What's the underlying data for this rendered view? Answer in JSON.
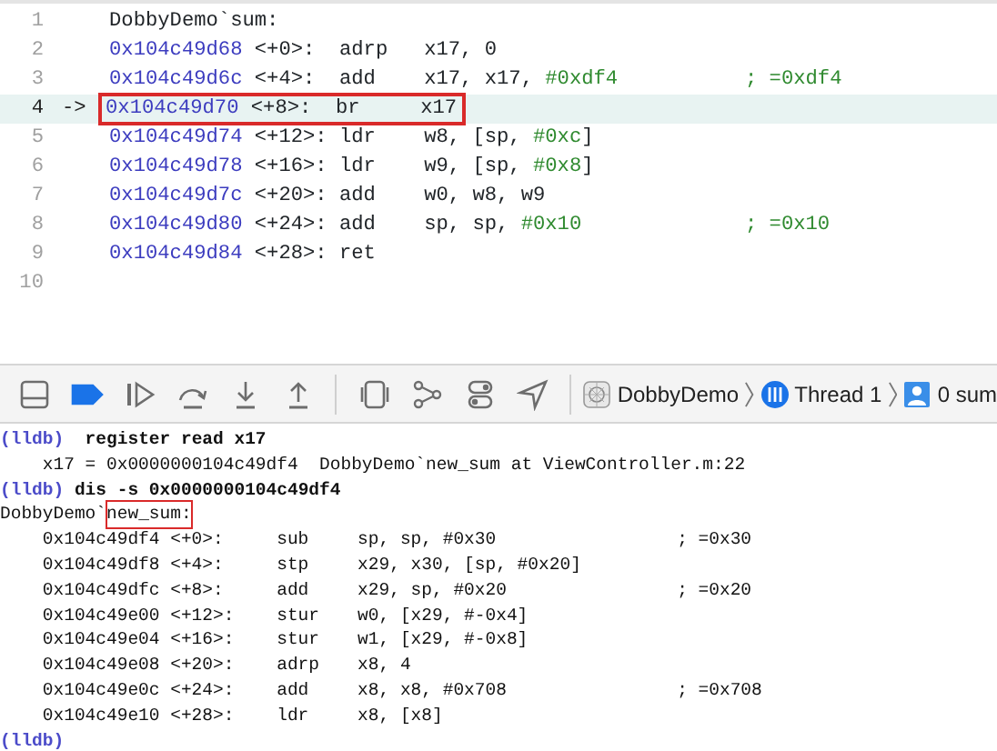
{
  "editor": {
    "lines": [
      {
        "number": "1",
        "kind": "label",
        "text": "DobbyDemo`sum:",
        "current": false,
        "annotated": false
      },
      {
        "number": "2",
        "kind": "instruction",
        "address": "0x104c49d68",
        "offset": "<+0>:",
        "mnemonic": "adrp",
        "operands": [
          {
            "kind": "plain",
            "text": "x17, 0"
          }
        ],
        "current": false,
        "annotated": false
      },
      {
        "number": "3",
        "kind": "instruction",
        "address": "0x104c49d6c",
        "offset": "<+4>:",
        "mnemonic": "add",
        "operands": [
          {
            "kind": "plain",
            "text": "x17, x17, "
          },
          {
            "kind": "imm",
            "text": "#0xdf4"
          }
        ],
        "comment": "; =0xdf4",
        "current": false,
        "annotated": false
      },
      {
        "number": "4",
        "kind": "instruction",
        "marker": "->",
        "address": "0x104c49d70",
        "offset": "<+8>:",
        "mnemonic": "br",
        "operands": [
          {
            "kind": "plain",
            "text": "x17"
          }
        ],
        "current": true,
        "annotated": true
      },
      {
        "number": "5",
        "kind": "instruction",
        "address": "0x104c49d74",
        "offset": "<+12>:",
        "mnemonic": "ldr",
        "operands": [
          {
            "kind": "plain",
            "text": "w8, [sp, "
          },
          {
            "kind": "imm",
            "text": "#0xc"
          },
          {
            "kind": "plain",
            "text": "]"
          }
        ],
        "current": false,
        "annotated": false
      },
      {
        "number": "6",
        "kind": "instruction",
        "address": "0x104c49d78",
        "offset": "<+16>:",
        "mnemonic": "ldr",
        "operands": [
          {
            "kind": "plain",
            "text": "w9, [sp, "
          },
          {
            "kind": "imm",
            "text": "#0x8"
          },
          {
            "kind": "plain",
            "text": "]"
          }
        ],
        "current": false,
        "annotated": false
      },
      {
        "number": "7",
        "kind": "instruction",
        "address": "0x104c49d7c",
        "offset": "<+20>:",
        "mnemonic": "add",
        "operands": [
          {
            "kind": "plain",
            "text": "w0, w8, w9"
          }
        ],
        "current": false,
        "annotated": false
      },
      {
        "number": "8",
        "kind": "instruction",
        "address": "0x104c49d80",
        "offset": "<+24>:",
        "mnemonic": "add",
        "operands": [
          {
            "kind": "plain",
            "text": "sp, sp, "
          },
          {
            "kind": "imm",
            "text": "#0x10"
          }
        ],
        "comment": "; =0x10",
        "current": false,
        "annotated": false
      },
      {
        "number": "9",
        "kind": "instruction",
        "address": "0x104c49d84",
        "offset": "<+28>:",
        "mnemonic": "ret",
        "current": false,
        "annotated": false
      },
      {
        "number": "10",
        "kind": "empty",
        "current": false,
        "annotated": false
      }
    ]
  },
  "debug_bar": {
    "buttons": [
      {
        "kind": "panel",
        "active": false
      },
      {
        "kind": "breakpoint",
        "active": true
      },
      {
        "kind": "continue",
        "active": false
      },
      {
        "kind": "step-over",
        "active": false
      },
      {
        "kind": "step-into",
        "active": false
      },
      {
        "kind": "step-out",
        "active": false
      },
      {
        "kind": "separator"
      },
      {
        "kind": "view-debugger",
        "active": false
      },
      {
        "kind": "memory-graph",
        "active": false
      },
      {
        "kind": "environment",
        "active": false
      },
      {
        "kind": "location",
        "active": false
      },
      {
        "kind": "separator"
      }
    ],
    "breadcrumbs": [
      {
        "label": "DobbyDemo"
      },
      {
        "label": "Thread 1"
      },
      {
        "label": "0 sum"
      }
    ]
  },
  "console": {
    "lines": [
      {
        "kind": "command",
        "prompt": "(lldb)",
        "text": " register read x17"
      },
      {
        "kind": "output",
        "text": "    x17 = 0x0000000104c49df4  DobbyDemo`new_sum at ViewController.m:22"
      },
      {
        "kind": "command",
        "prompt": "(lldb)",
        "text": "dis -s 0x0000000104c49df4"
      },
      {
        "kind": "header",
        "text": "DobbyDemo`",
        "boxed": "new_sum:"
      },
      {
        "kind": "instruction",
        "address": "0x104c49df4",
        "offset": "<+0>:",
        "mnemonic": "sub",
        "operands": "sp, sp, #0x30",
        "comment": "; =0x30"
      },
      {
        "kind": "instruction",
        "address": "0x104c49df8",
        "offset": "<+4>:",
        "mnemonic": "stp",
        "operands": "x29, x30, [sp, #0x20]"
      },
      {
        "kind": "instruction",
        "address": "0x104c49dfc",
        "offset": "<+8>:",
        "mnemonic": "add",
        "operands": "x29, sp, #0x20",
        "comment": "; =0x20"
      },
      {
        "kind": "instruction",
        "address": "0x104c49e00",
        "offset": "<+12>:",
        "mnemonic": "stur",
        "operands": "w0, [x29, #-0x4]"
      },
      {
        "kind": "instruction",
        "address": "0x104c49e04",
        "offset": "<+16>:",
        "mnemonic": "stur",
        "operands": "w1, [x29, #-0x8]"
      },
      {
        "kind": "instruction",
        "address": "0x104c49e08",
        "offset": "<+20>:",
        "mnemonic": "adrp",
        "operands": "x8, 4"
      },
      {
        "kind": "instruction",
        "address": "0x104c49e0c",
        "offset": "<+24>:",
        "mnemonic": "add",
        "operands": "x8, x8, #0x708",
        "comment": "; =0x708"
      },
      {
        "kind": "instruction",
        "address": "0x104c49e10",
        "offset": "<+28>:",
        "mnemonic": "ldr",
        "operands": "x8, [x8]"
      },
      {
        "kind": "prompt",
        "prompt": "(lldb)"
      }
    ]
  }
}
